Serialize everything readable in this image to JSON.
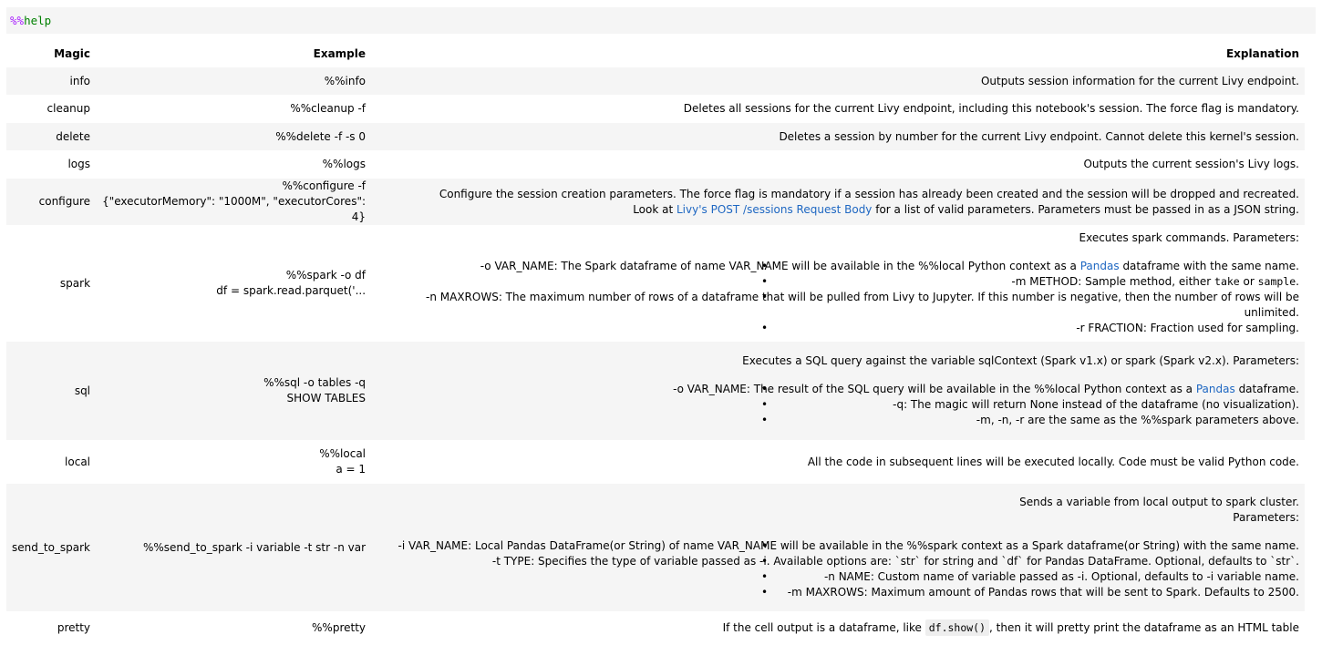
{
  "cell": {
    "prefix": "%%",
    "command": "help"
  },
  "headers": {
    "magic": "Magic",
    "example": "Example",
    "explanation": "Explanation"
  },
  "rows": {
    "info": {
      "magic": "info",
      "example": "%%info",
      "explanation": "Outputs session information for the current Livy endpoint."
    },
    "cleanup": {
      "magic": "cleanup",
      "example": "%%cleanup -f",
      "explanation": "Deletes all sessions for the current Livy endpoint, including this notebook's session. The force flag is mandatory."
    },
    "delete": {
      "magic": "delete",
      "example": "%%delete -f -s 0",
      "explanation": "Deletes a session by number for the current Livy endpoint. Cannot delete this kernel's session."
    },
    "logs": {
      "magic": "logs",
      "example": "%%logs",
      "explanation": "Outputs the current session's Livy logs."
    },
    "configure": {
      "magic": "configure",
      "example_1": "%%configure -f",
      "example_2": "{\"executorMemory\": \"1000M\", \"executorCores\": 4}",
      "explanation_1": "Configure the session creation parameters. The force flag is mandatory if a session has already been created and the session will be dropped and recreated.",
      "explanation_2a": "Look at ",
      "explanation_link": "Livy's POST /sessions Request Body",
      "explanation_2b": " for a list of valid parameters. Parameters must be passed in as a JSON string."
    },
    "spark": {
      "magic": "spark",
      "example_1": "%%spark -o df",
      "example_2": "df = spark.read.parquet('...",
      "intro": "Executes spark commands. Parameters:",
      "item1a": "-o VAR_NAME: The Spark dataframe of name VAR_NAME will be available in the %%local Python context as a ",
      "item1_link": "Pandas",
      "item1b": " dataframe with the same name.",
      "item2a": "-m METHOD: Sample method, either ",
      "item2_code1": "take",
      "item2_mid": " or ",
      "item2_code2": "sample",
      "item2b": ".",
      "item3": "-n MAXROWS: The maximum number of rows of a dataframe that will be pulled from Livy to Jupyter. If this number is negative, then the number of rows will be unlimited.",
      "item4": "-r FRACTION: Fraction used for sampling."
    },
    "sql": {
      "magic": "sql",
      "example_1": "%%sql -o tables -q",
      "example_2": "SHOW TABLES",
      "intro": "Executes a SQL query against the variable sqlContext (Spark v1.x) or spark (Spark v2.x). Parameters:",
      "item1a": "-o VAR_NAME: The result of the SQL query will be available in the %%local Python context as a ",
      "item1_link": "Pandas",
      "item1b": " dataframe.",
      "item2": "-q: The magic will return None instead of the dataframe (no visualization).",
      "item3": "-m, -n, -r are the same as the %%spark parameters above."
    },
    "local": {
      "magic": "local",
      "example_1": "%%local",
      "example_2": "a = 1",
      "explanation": "All the code in subsequent lines will be executed locally. Code must be valid Python code."
    },
    "send_to_spark": {
      "magic": "send_to_spark",
      "example": "%%send_to_spark -i variable -t str -n var",
      "intro_1": "Sends a variable from local output to spark cluster.",
      "intro_2": "Parameters:",
      "item1": "-i VAR_NAME: Local Pandas DataFrame(or String) of name VAR_NAME will be available in the %%spark context as a Spark dataframe(or String) with the same name.",
      "item2": "-t TYPE: Specifies the type of variable passed as -i. Available options are: `str` for string and `df` for Pandas DataFrame. Optional, defaults to `str`.",
      "item3": "-n NAME: Custom name of variable passed as -i. Optional, defaults to -i variable name.",
      "item4": "-m MAXROWS: Maximum amount of Pandas rows that will be sent to Spark. Defaults to 2500."
    },
    "pretty": {
      "magic": "pretty",
      "example": "%%pretty",
      "explanation_a": "If the cell output is a dataframe, like ",
      "explanation_code": "df.show()",
      "explanation_b": ", then it will pretty print the dataframe as an HTML table"
    }
  }
}
